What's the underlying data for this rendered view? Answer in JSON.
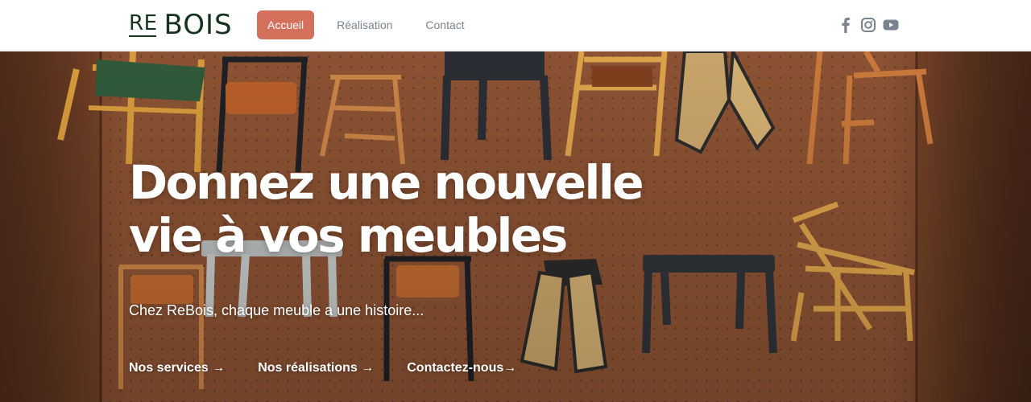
{
  "brand": {
    "logo_re": "RE",
    "logo_bois": "BOIS",
    "color": "#16331f"
  },
  "nav": {
    "items": [
      {
        "label": "Accueil",
        "active": true
      },
      {
        "label": "Réalisation",
        "active": false
      },
      {
        "label": "Contact",
        "active": false
      }
    ],
    "accent": "#d4715c"
  },
  "socials": [
    {
      "icon": "facebook-icon"
    },
    {
      "icon": "instagram-icon"
    },
    {
      "icon": "youtube-icon"
    }
  ],
  "hero": {
    "title": "Donnez une nouvelle\nvie à vos meubles",
    "subtitle": "Chez ReBois, chaque meuble a une histoire...",
    "links": [
      {
        "label": "Nos services →"
      },
      {
        "label": "Nos réalisations →"
      },
      {
        "label": "Contactez-nous→"
      }
    ],
    "background": "chairs-on-pegboard-photo"
  }
}
